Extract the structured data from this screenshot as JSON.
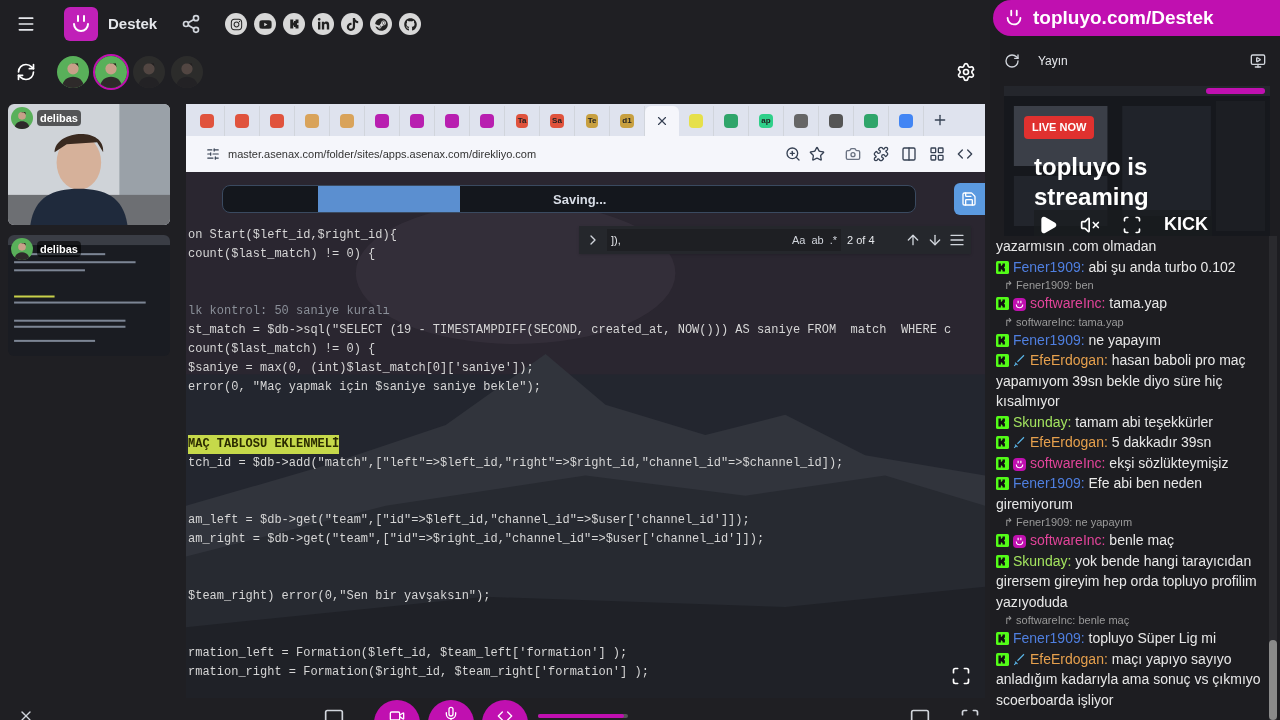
{
  "top_bar": {
    "title": "Destek"
  },
  "avatars": [
    {
      "selected": false,
      "active": true
    },
    {
      "selected": true,
      "active": true
    },
    {
      "selected": false,
      "active": false
    },
    {
      "selected": false,
      "active": false
    }
  ],
  "video_tiles": [
    {
      "name": "delibas",
      "kind": "camera"
    },
    {
      "name": "delibas",
      "kind": "screen"
    }
  ],
  "browser": {
    "tabs": [
      {
        "color": "#e0533d",
        "selected": false
      },
      {
        "color": "#e0533d",
        "selected": false
      },
      {
        "color": "#e0533d",
        "selected": false
      },
      {
        "color": "#d9a35a",
        "selected": false
      },
      {
        "color": "#d9a35a",
        "selected": false
      },
      {
        "color": "#b81fb0",
        "selected": false
      },
      {
        "color": "#b81fb0",
        "selected": false
      },
      {
        "color": "#b81fb0",
        "selected": false
      },
      {
        "color": "#b81fb0",
        "selected": false
      },
      {
        "color": "#e0533d",
        "label": "Ta",
        "selected": false
      },
      {
        "color": "#e0533d",
        "label": "Sa",
        "selected": false
      },
      {
        "color": "#c8a040",
        "label": "Te",
        "selected": false
      },
      {
        "color": "#c8a040",
        "label": "d1",
        "selected": false
      },
      {
        "selected": true
      },
      {
        "color": "#e6e04a",
        "selected": false
      },
      {
        "color": "#2fa56a",
        "selected": false
      },
      {
        "color": "#2fd08a",
        "label": "ap",
        "selected": false
      },
      {
        "color": "#666666",
        "selected": false
      },
      {
        "color": "#555555",
        "selected": false
      },
      {
        "color": "#2fa56a",
        "selected": false
      },
      {
        "color": "#4285f4",
        "selected": false
      }
    ],
    "url": "master.asenax.com/folder/sites/apps.asenax.com/direkliyo.com"
  },
  "editor": {
    "status": "Saving...",
    "progress": {
      "level": 0.2
    },
    "volume": {
      "level": 0.95
    },
    "find": {
      "value": "]),",
      "options": [
        "Aa",
        "ab",
        ".*"
      ],
      "match_count": "2 of 4"
    },
    "code_blocks": [
      [
        {
          "kind": "code",
          "text": "on Start($left_id,$right_id){"
        },
        {
          "kind": "code",
          "text": "count($last_match) != 0) {"
        }
      ],
      [
        {
          "kind": "comment",
          "text": "lk kontrol: 50 saniye kuralı"
        },
        {
          "kind": "code",
          "text": "st_match = $db->sql(\"SELECT (19 - TIMESTAMPDIFF(SECOND, created_at, NOW())) AS saniye FROM  match  WHERE c"
        },
        {
          "kind": "code",
          "text": "count($last_match) != 0) {"
        },
        {
          "kind": "code",
          "text": "$saniye = max(0, (int)$last_match[0]['saniye']);"
        },
        {
          "kind": "code",
          "text": "error(0, \"Maç yapmak için $saniye saniye bekle\");"
        }
      ],
      [
        {
          "kind": "highlight",
          "text": "MAÇ TABLOSU EKLENMELİ"
        },
        {
          "kind": "code",
          "text": "tch_id = $db->add(\"match\",[\"left\"=>$left_id,\"right\"=>$right_id,\"channel_id\"=>$channel_id]);"
        }
      ],
      [
        {
          "kind": "code",
          "text": "am_left = $db->get(\"team\",[\"id\"=>$left_id,\"channel_id\"=>$user['channel_id']]);"
        },
        {
          "kind": "code",
          "text": "am_right = $db->get(\"team\",[\"id\"=>$right_id,\"channel_id\"=>$user['channel_id']]);"
        }
      ],
      [
        {
          "kind": "code",
          "text": "$team_right) error(0,\"Sen bir yavşaksın\");"
        }
      ],
      [
        {
          "kind": "code",
          "text": "rmation_left = Formation($left_id, $team_left['formation'] );"
        },
        {
          "kind": "code",
          "text": "rmation_right = Formation($right_id, $team_right['formation'] );"
        }
      ]
    ]
  },
  "banner": {
    "text": "topluyo.com/Destek"
  },
  "stream": {
    "header": "Yayın",
    "badge": "LIVE NOW",
    "title_lines": [
      "topluyo is",
      "streaming"
    ],
    "platform": "KICK"
  },
  "chat": [
    {
      "kind": "continuation",
      "text": "yazarmısın .com olmadan"
    },
    {
      "kind": "message",
      "user": "Fener1909:",
      "owner_badge": false,
      "moderator_badge": false,
      "color": "#4f7fe0",
      "text": "abi şu anda turbo 0.102"
    },
    {
      "kind": "reply",
      "text": "↱ Fener1909: ben"
    },
    {
      "kind": "message",
      "user": "softwareInc:",
      "owner_badge": true,
      "moderator_badge": false,
      "color": "#e2449a",
      "text": "tama.yap"
    },
    {
      "kind": "reply",
      "text": "↱ softwareInc: tama.yap"
    },
    {
      "kind": "message",
      "user": "Fener1909:",
      "owner_badge": false,
      "moderator_badge": false,
      "color": "#4f7fe0",
      "text": "ne yapayım"
    },
    {
      "kind": "message",
      "user": "EfeErdogan:",
      "owner_badge": false,
      "moderator_badge": true,
      "color": "#e6a04d",
      "text": "hasan baboli pro maç yapamıyom 39sn bekle diyo süre hiç kısalmıyor"
    },
    {
      "kind": "message",
      "user": "Skunday:",
      "owner_badge": false,
      "moderator_badge": false,
      "color": "#a3e35f",
      "text": "tamam abi teşekkürler"
    },
    {
      "kind": "message",
      "user": "EfeErdogan:",
      "owner_badge": false,
      "moderator_badge": true,
      "color": "#e6a04d",
      "text": "5 dakkadır 39sn"
    },
    {
      "kind": "message",
      "user": "softwareInc:",
      "owner_badge": true,
      "moderator_badge": false,
      "color": "#e2449a",
      "text": "ekşi sözlükteymişiz"
    },
    {
      "kind": "message",
      "user": "Fener1909:",
      "owner_badge": false,
      "moderator_badge": false,
      "color": "#4f7fe0",
      "text": "Efe abi ben neden giremiyorum"
    },
    {
      "kind": "reply",
      "text": "↱ Fener1909: ne yapayım"
    },
    {
      "kind": "message",
      "user": "softwareInc:",
      "owner_badge": true,
      "moderator_badge": false,
      "color": "#e2449a",
      "text": "benle maç"
    },
    {
      "kind": "message",
      "user": "Skunday:",
      "owner_badge": false,
      "moderator_badge": false,
      "color": "#a3e35f",
      "text": "yok bende hangi tarayıcıdan girersem gireyim hep orda topluyo profilim yazıyoduda"
    },
    {
      "kind": "reply",
      "text": "↱ softwareInc: benle maç"
    },
    {
      "kind": "message",
      "user": "Fener1909:",
      "owner_badge": false,
      "moderator_badge": false,
      "color": "#4f7fe0",
      "text": "topluyo Süper Lig mi"
    },
    {
      "kind": "message",
      "user": "EfeErdogan:",
      "owner_badge": false,
      "moderator_badge": true,
      "color": "#e6a04d",
      "text": "maçı yapıyo sayıyo anladığım kadarıyla ama sonuç vs çıkmıyo scoerboarda işliyor"
    }
  ]
}
